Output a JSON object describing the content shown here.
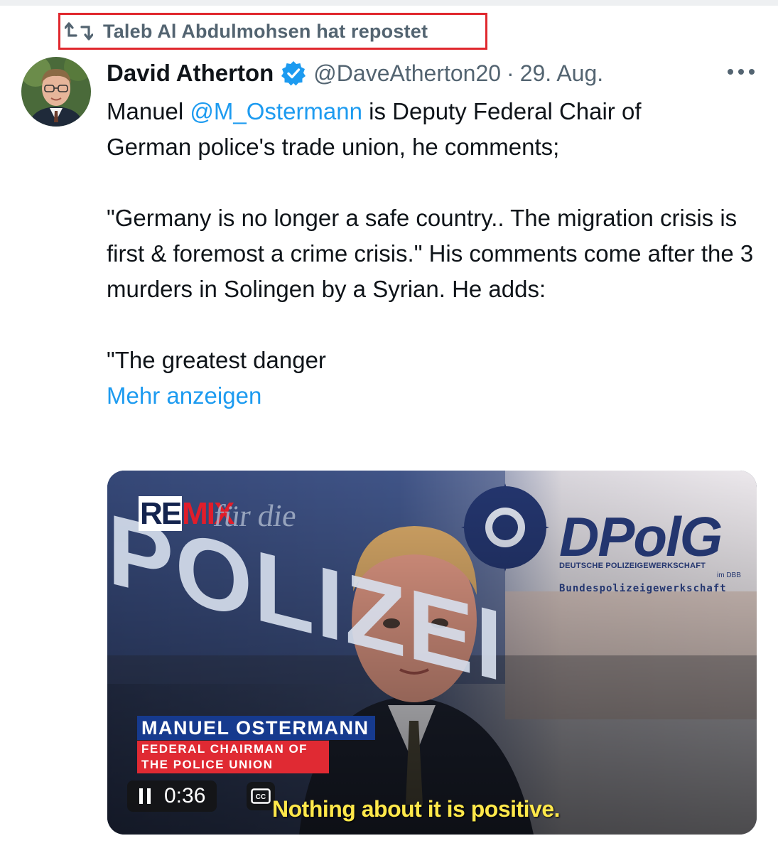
{
  "repost": {
    "text": "Taleb Al Abdulmohsen hat repostet",
    "icon": "repost-icon"
  },
  "author": {
    "name": "David Atherton",
    "handle": "@DaveAtherton20",
    "separator": "·",
    "date": "29. Aug.",
    "verified_icon": "verified-badge-icon"
  },
  "post": {
    "line1_prefix": "Manuel ",
    "mention": "@M_Ostermann",
    "line1_suffix": " is Deputy Federal Chair of",
    "line2": "German police's trade union, he comments;",
    "para2": "\"Germany is no longer a safe country.. The migration crisis is first & foremost a crime crisis.\" His comments come after the 3 murders in Solingen by a Syrian. He adds:",
    "para3": "\"The greatest danger",
    "show_more": "Mehr anzeigen"
  },
  "video": {
    "brand_re": "RE",
    "brand_mix": "MIX",
    "bg_text_fur": "für die",
    "bg_text_polizei": "POLIZEI",
    "logo_title": "DPolG",
    "logo_sub1": "DEUTSCHE POLIZEIGEWERKSCHAFT",
    "logo_sub2": "im DBB",
    "logo_sub3": "Bundespolizeigewerkschaft",
    "lower_third_name": "MANUEL OSTERMANN",
    "lower_third_title": "FEDERAL CHAIRMAN OF THE POLICE UNION",
    "time": "0:36",
    "cc_label": "CC",
    "caption": "Nothing about it is positive."
  },
  "colors": {
    "accent": "#1d9bf0",
    "muted": "#536471",
    "highlight_border": "#e0282e",
    "lower_third_blue": "#163a8e",
    "lower_third_red": "#e02a33",
    "caption_yellow": "#ffe84a"
  }
}
